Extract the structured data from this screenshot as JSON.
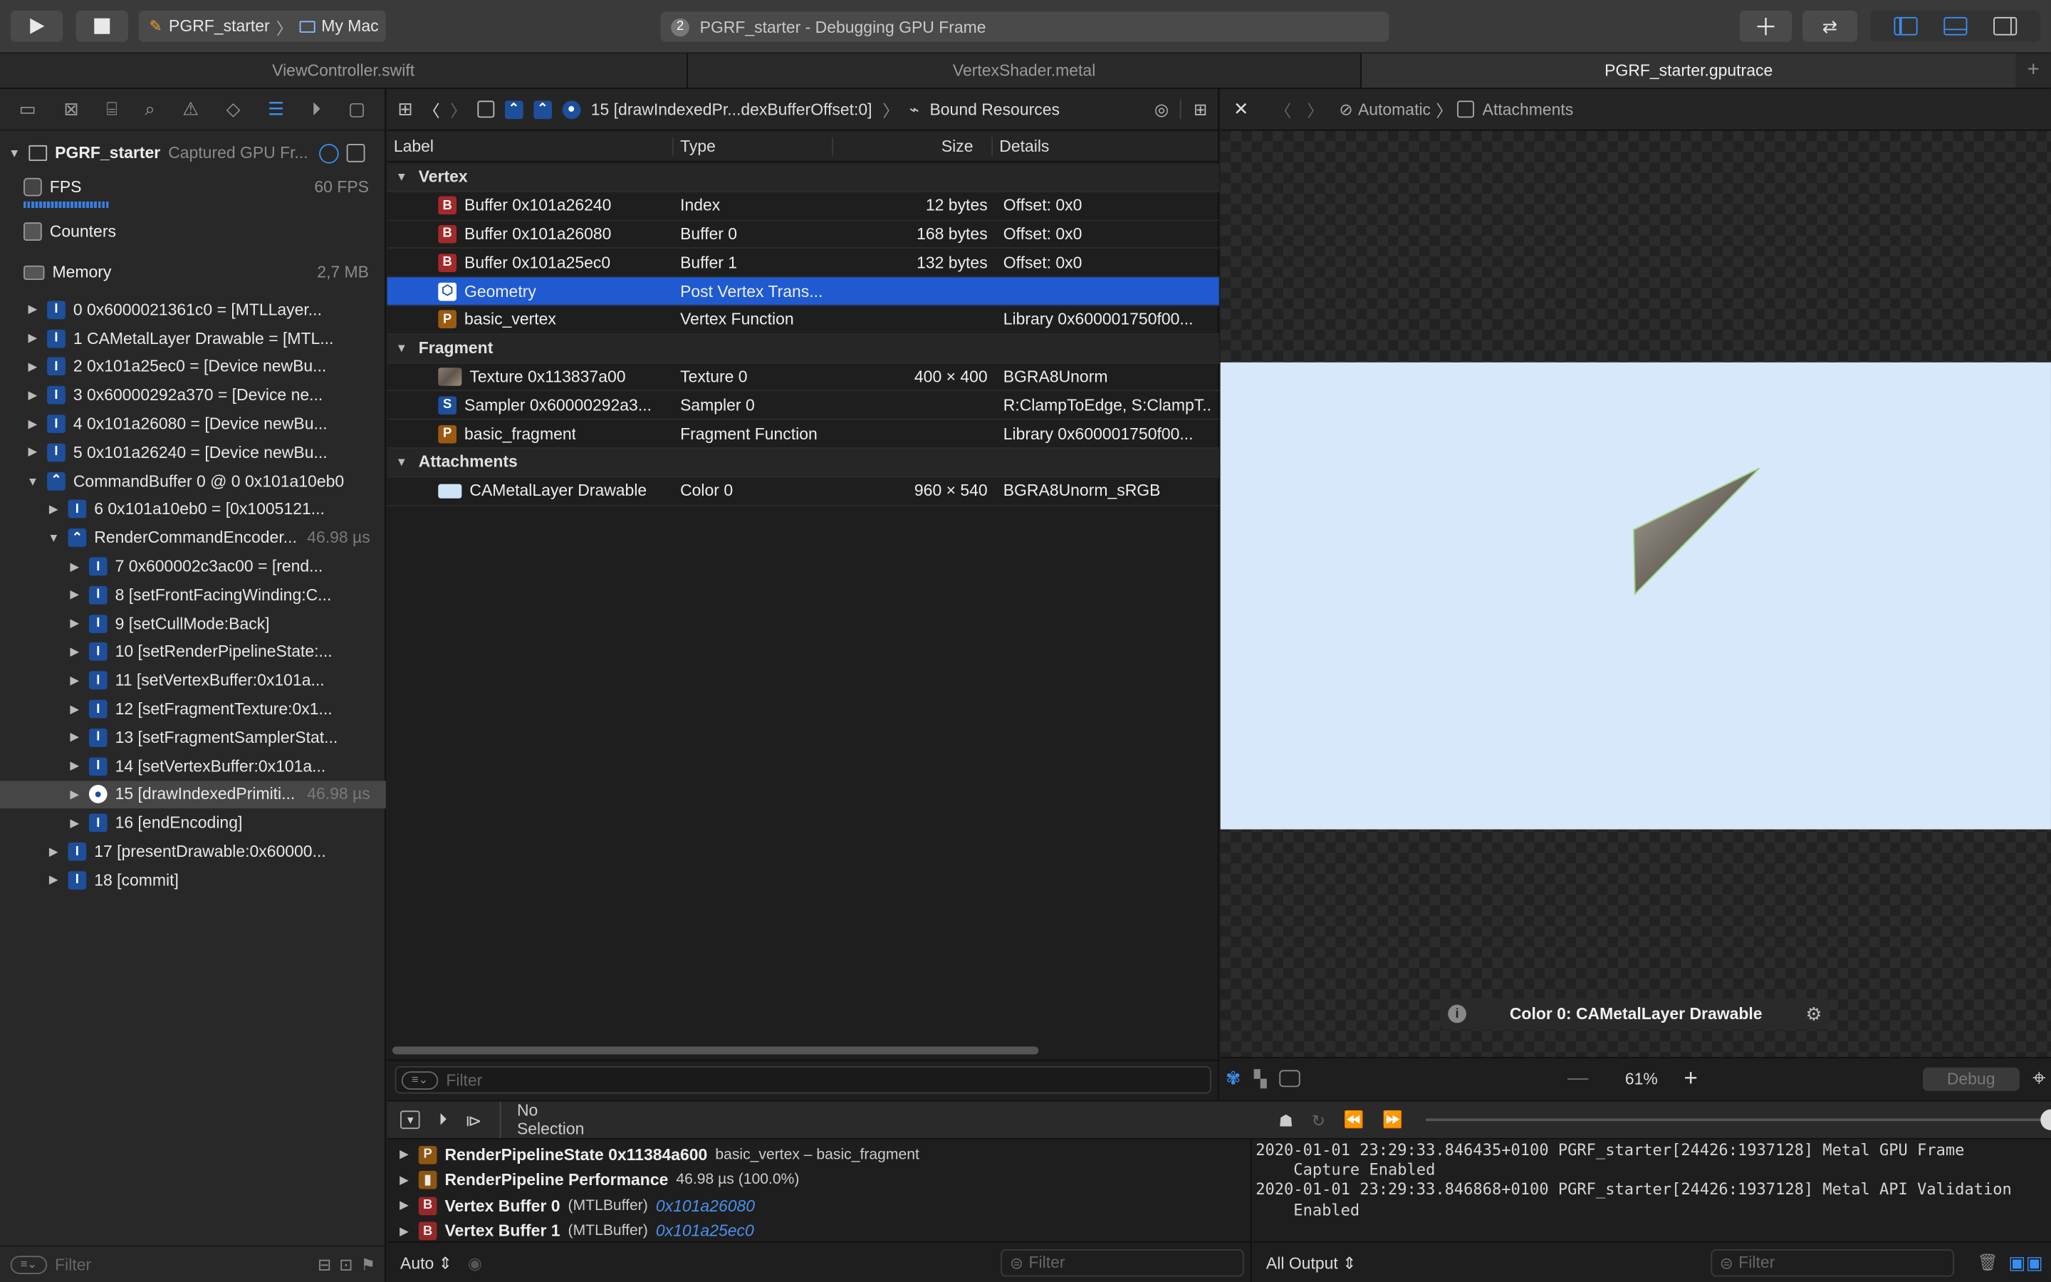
{
  "toolbar": {
    "scheme": "PGRF_starter",
    "destination": "My Mac",
    "activity_count": "2",
    "activity": "PGRF_starter - Debugging GPU Frame"
  },
  "tabs": [
    "ViewController.swift",
    "VertexShader.metal",
    "PGRF_starter.gputrace"
  ],
  "nav": {
    "root_name": "PGRF_starter",
    "root_sub": "Captured GPU Fr...",
    "fps_label": "FPS",
    "fps_value": "60 FPS",
    "counters_label": "Counters",
    "memory_label": "Memory",
    "memory_value": "2,7 MB",
    "items": [
      {
        "label": "0 0x6000021361c0 = [MTLLayer...",
        "indent": 1,
        "badge": "I",
        "exp": "right"
      },
      {
        "label": "1 CAMetalLayer Drawable = [MTL...",
        "indent": 1,
        "badge": "I",
        "exp": "right"
      },
      {
        "label": "2 0x101a25ec0 = [Device newBu...",
        "indent": 1,
        "badge": "I",
        "exp": "right"
      },
      {
        "label": "3 0x60000292a370 = [Device ne...",
        "indent": 1,
        "badge": "I",
        "exp": "right"
      },
      {
        "label": "4 0x101a26080 = [Device newBu...",
        "indent": 1,
        "badge": "I",
        "exp": "right"
      },
      {
        "label": "5 0x101a26240 = [Device newBu...",
        "indent": 1,
        "badge": "I",
        "exp": "right"
      },
      {
        "label": "CommandBuffer 0 @ 0 0x101a10eb0",
        "indent": 1,
        "badge": "C",
        "exp": "down"
      },
      {
        "label": "6 0x101a10eb0 = [0x1005121...",
        "indent": 2,
        "badge": "I",
        "exp": "right"
      },
      {
        "label": "RenderCommandEncoder...",
        "indent": 2,
        "badge": "R",
        "exp": "down",
        "time": "46.98 µs"
      },
      {
        "label": "7 0x600002c3ac00 = [rend...",
        "indent": 3,
        "badge": "I",
        "exp": "right"
      },
      {
        "label": "8 [setFrontFacingWinding:C...",
        "indent": 3,
        "badge": "I",
        "exp": "right"
      },
      {
        "label": "9 [setCullMode:Back]",
        "indent": 3,
        "badge": "I",
        "exp": "right"
      },
      {
        "label": "10 [setRenderPipelineState:...",
        "indent": 3,
        "badge": "I",
        "exp": "right"
      },
      {
        "label": "11 [setVertexBuffer:0x101a...",
        "indent": 3,
        "badge": "I",
        "exp": "right"
      },
      {
        "label": "12 [setFragmentTexture:0x1...",
        "indent": 3,
        "badge": "I",
        "exp": "right"
      },
      {
        "label": "13 [setFragmentSamplerStat...",
        "indent": 3,
        "badge": "I",
        "exp": "right"
      },
      {
        "label": "14 [setVertexBuffer:0x101a...",
        "indent": 3,
        "badge": "I",
        "exp": "right"
      },
      {
        "label": "15 [drawIndexedPrimiti...",
        "indent": 3,
        "badge": "D",
        "exp": "right",
        "time": "46.98 µs",
        "selected": true
      },
      {
        "label": "16 [endEncoding]",
        "indent": 3,
        "badge": "I",
        "exp": "right"
      },
      {
        "label": "17 [presentDrawable:0x60000...",
        "indent": 2,
        "badge": "I",
        "exp": "right"
      },
      {
        "label": "18 [commit]",
        "indent": 2,
        "badge": "I",
        "exp": "right"
      }
    ],
    "filter_placeholder": "Filter"
  },
  "jumpbar": {
    "call": "15 [drawIndexedPr...dexBufferOffset:0]",
    "resources": "Bound Resources"
  },
  "table": {
    "headers": [
      "Label",
      "Type",
      "Size",
      "Details"
    ],
    "rows": [
      {
        "kind": "group",
        "label": "Vertex"
      },
      {
        "badge": "B",
        "label": "Buffer 0x101a26240",
        "type": "Index",
        "size": "12 bytes",
        "details": "Offset: 0x0"
      },
      {
        "badge": "B",
        "label": "Buffer 0x101a26080",
        "type": "Buffer 0",
        "size": "168 bytes",
        "details": "Offset: 0x0"
      },
      {
        "badge": "B",
        "label": "Buffer 0x101a25ec0",
        "type": "Buffer 1",
        "size": "132 bytes",
        "details": "Offset: 0x0"
      },
      {
        "badge": "G",
        "label": "Geometry",
        "type": "Post Vertex Trans...",
        "size": "",
        "details": "",
        "selected": true
      },
      {
        "badge": "P",
        "label": "basic_vertex",
        "type": "Vertex Function",
        "size": "",
        "details": "Library 0x600001750f00..."
      },
      {
        "kind": "group",
        "label": "Fragment"
      },
      {
        "badge": "T",
        "label": "Texture 0x113837a00",
        "type": "Texture 0",
        "size": "400 × 400",
        "details": "BGRA8Unorm"
      },
      {
        "badge": "S",
        "label": "Sampler 0x60000292a3...",
        "type": "Sampler 0",
        "size": "",
        "details": "R:ClampToEdge, S:ClampT..."
      },
      {
        "badge": "P",
        "label": "basic_fragment",
        "type": "Fragment Function",
        "size": "",
        "details": "Library 0x600001750f00..."
      },
      {
        "kind": "group",
        "label": "Attachments"
      },
      {
        "badge": "A",
        "label": "CAMetalLayer Drawable",
        "type": "Color 0",
        "size": "960 × 540",
        "details": "BGRA8Unorm_sRGB"
      }
    ],
    "filter_placeholder": "Filter"
  },
  "viewer": {
    "auto": "Automatic",
    "attachments": "Attachments",
    "caption": "Color 0: CAMetalLayer Drawable",
    "zoom": "61%",
    "debug": "Debug"
  },
  "debugbar": {
    "selection": "No Selection"
  },
  "vars": [
    {
      "badge": "P",
      "name": "RenderPipelineState 0x11384a600",
      "extra": "basic_vertex – basic_fragment",
      "link": ""
    },
    {
      "badge": "R",
      "name": "RenderPipeline Performance",
      "extra": "46.98 µs (100.0%)",
      "link": ""
    },
    {
      "badge": "B",
      "name": "Vertex Buffer 0",
      "extra": "(MTLBuffer)",
      "link": "0x101a26080"
    },
    {
      "badge": "B",
      "name": "Vertex Buffer 1",
      "extra": "(MTLBuffer)",
      "link": "0x101a25ec0"
    }
  ],
  "bottom": {
    "auto": "Auto",
    "filter": "Filter",
    "output": "All Output",
    "filter2": "Filter"
  },
  "console": [
    "2020-01-01 23:29:33.846435+0100 PGRF_starter[24426:1937128] Metal GPU Frame",
    "    Capture Enabled",
    "2020-01-01 23:29:33.846868+0100 PGRF_starter[24426:1937128] Metal API Validation",
    "    Enabled"
  ]
}
